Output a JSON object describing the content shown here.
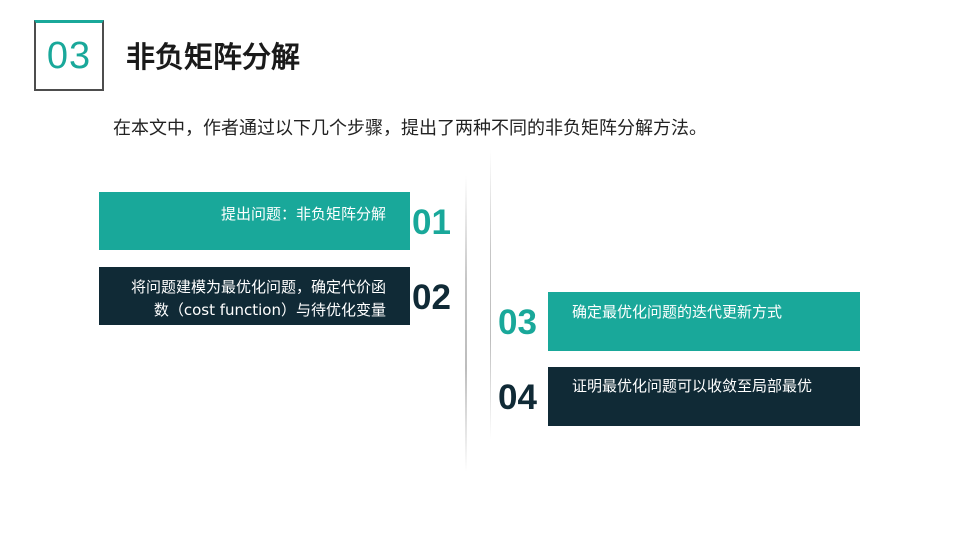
{
  "section": {
    "number": "03",
    "title": "非负矩阵分解"
  },
  "intro": "在本文中，作者通过以下几个步骤，提出了两种不同的非负矩阵分解方法。",
  "steps": [
    {
      "number": "01",
      "text": "提出问题：非负矩阵分解"
    },
    {
      "number": "02",
      "text": "将问题建模为最优化问题，确定代价函数（cost function）与待优化变量"
    },
    {
      "number": "03",
      "text": "确定最优化问题的迭代更新方式"
    },
    {
      "number": "04",
      "text": "证明最优化问题可以收敛至局部最优"
    }
  ],
  "colors": {
    "accent": "#19a89a",
    "dark": "#102a36"
  }
}
